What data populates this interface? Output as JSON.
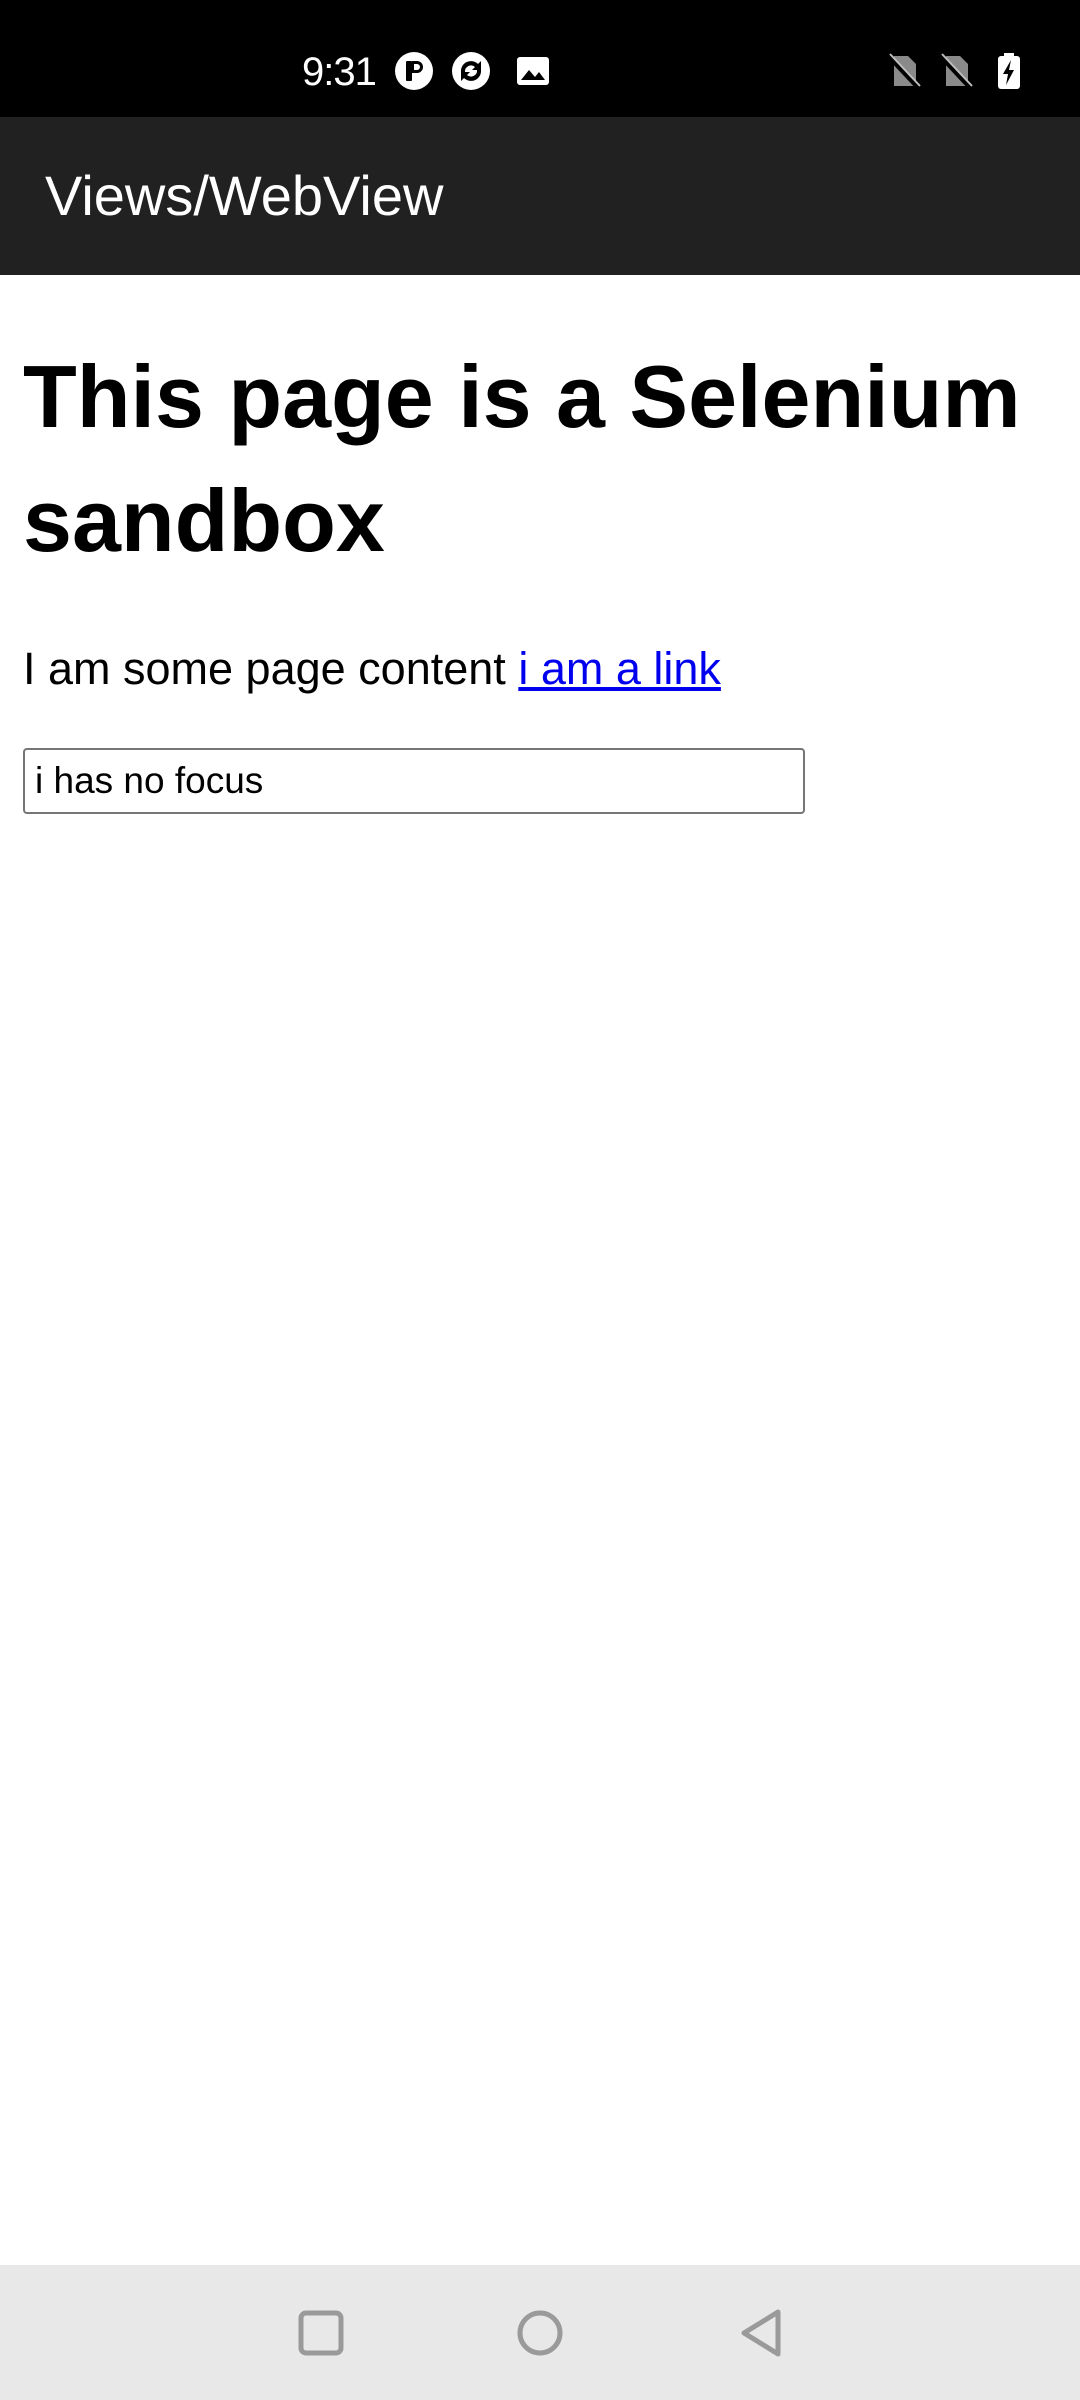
{
  "status_bar": {
    "time": "9:31",
    "icons": [
      "notification-app-icon",
      "sync-app-icon",
      "image-icon",
      "no-sim-icon",
      "no-sim-icon",
      "battery-charging-icon"
    ]
  },
  "app_bar": {
    "title": "Views/WebView"
  },
  "webview": {
    "heading": "This page is a Selenium sandbox",
    "paragraph_text": "I am some page content",
    "link_text": "i am a link",
    "input_value": "i has no focus",
    "link_color": "#0000ee"
  },
  "nav_bar": {
    "buttons": [
      "recents-icon",
      "home-icon",
      "back-icon"
    ]
  },
  "colors": {
    "status_bar_bg": "#000000",
    "app_bar_bg": "#212121",
    "page_bg": "#ffffff",
    "nav_bar_bg": "#e8e8e8"
  }
}
